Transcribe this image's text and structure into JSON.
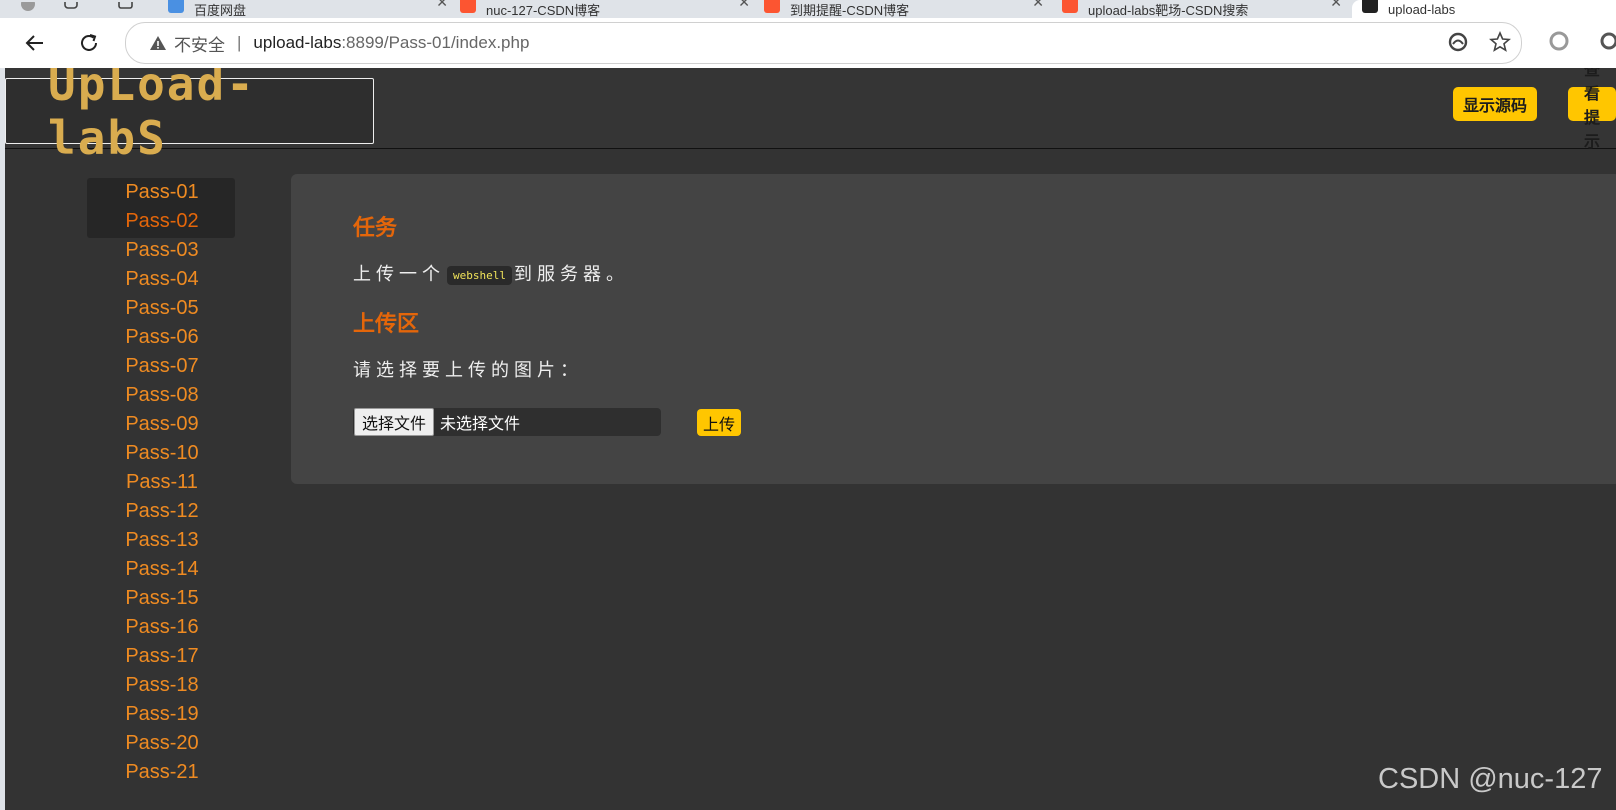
{
  "browser": {
    "tabs": [
      {
        "label": "百度网盘",
        "icon": "baidu-netdisk-icon",
        "color": "#4a90e2"
      },
      {
        "label": "nuc-127-CSDN博客",
        "icon": "csdn-icon",
        "color": "#fc5531"
      },
      {
        "label": "到期提醒-CSDN博客",
        "icon": "csdn-icon",
        "color": "#fc5531"
      },
      {
        "label": "upload-labs靶场-CSDN搜索",
        "icon": "csdn-icon",
        "color": "#fc5531"
      },
      {
        "label": "upload-labs",
        "icon": "page-icon",
        "color": "#222222"
      }
    ],
    "address": {
      "security_label": "不安全",
      "separator": "|",
      "host": "upload-labs",
      "path": ":8899/Pass-01/index.php"
    }
  },
  "header": {
    "logo_text": "UpLoad-labS",
    "buttons": {
      "show_source": "显示源码",
      "view_hint": "查看提示"
    }
  },
  "sidebar": {
    "items": [
      "Pass-01",
      "Pass-02",
      "Pass-03",
      "Pass-04",
      "Pass-05",
      "Pass-06",
      "Pass-07",
      "Pass-08",
      "Pass-09",
      "Pass-10",
      "Pass-11",
      "Pass-12",
      "Pass-13",
      "Pass-14",
      "Pass-15",
      "Pass-16",
      "Pass-17",
      "Pass-18",
      "Pass-19",
      "Pass-20",
      "Pass-21"
    ],
    "active_index": 1
  },
  "main": {
    "task_title": "任务",
    "task_prefix": "上传一个",
    "task_code": "webshell",
    "task_suffix": "到服务器。",
    "upload_title": "上传区",
    "upload_prompt": "请选择要上传的图片：",
    "file_button": "选择文件",
    "file_status": "未选择文件",
    "upload_button": "上传"
  },
  "watermark": "CSDN @nuc-127",
  "colors": {
    "accent": "#ffc600",
    "heading": "#e4660a",
    "link": "#ef8b22",
    "active_link": "#e4660a",
    "logo": "#d9ac4f"
  }
}
